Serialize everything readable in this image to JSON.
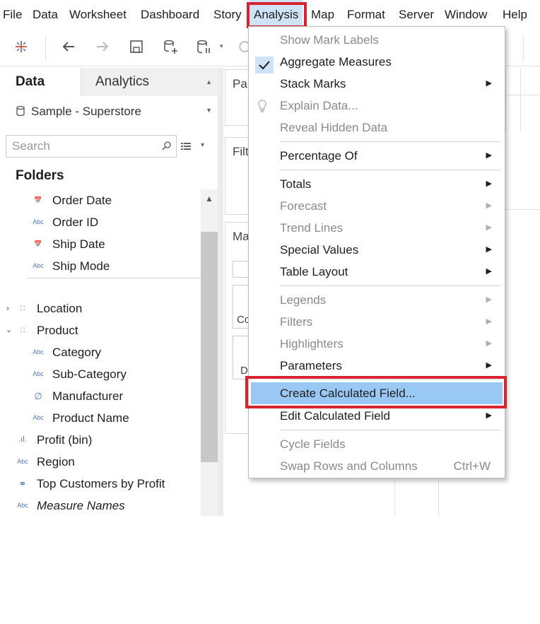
{
  "menubar": {
    "items": [
      "File",
      "Data",
      "Worksheet",
      "Dashboard",
      "Story",
      "Analysis",
      "Map",
      "Format",
      "Server",
      "Window",
      "Help"
    ]
  },
  "toolbar": {
    "icons": [
      "tableau-logo-icon",
      "back-icon",
      "forward-icon",
      "save-icon",
      "new-datasource-icon",
      "pause-updates-icon",
      "refresh-icon"
    ]
  },
  "left_pane": {
    "tab_data": "Data",
    "tab_analytics": "Analytics",
    "datasource": "Sample - Superstore",
    "search_placeholder": "Search",
    "folders_title": "Folders",
    "fields": [
      {
        "icon": "calendar",
        "label": "Order Date"
      },
      {
        "icon": "Abc",
        "label": "Order ID"
      },
      {
        "icon": "calendar",
        "label": "Ship Date"
      },
      {
        "icon": "Abc",
        "label": "Ship Mode"
      },
      {
        "icon": "hierarchy",
        "label": "Location"
      },
      {
        "icon": "hierarchy",
        "label": "Product"
      },
      {
        "icon": "Abc",
        "label": "Category"
      },
      {
        "icon": "Abc",
        "label": "Sub-Category"
      },
      {
        "icon": "paperclip",
        "label": "Manufacturer"
      },
      {
        "icon": "Abc",
        "label": "Product Name"
      },
      {
        "icon": "bin",
        "label": "Profit (bin)"
      },
      {
        "icon": "Abc",
        "label": "Region"
      },
      {
        "icon": "set",
        "label": "Top Customers by Profit"
      },
      {
        "icon": "Abc",
        "label": "Measure Names"
      }
    ]
  },
  "shelves": {
    "pages_partial": "Pa",
    "filters_partial": "Filt",
    "marks_partial": "Ma",
    "color_partial": "Co",
    "detail_partial": "D"
  },
  "analysis_menu": {
    "items": [
      {
        "label": "Show Mark Labels",
        "enabled": false
      },
      {
        "label": "Aggregate Measures",
        "enabled": true,
        "checked": true
      },
      {
        "label": "Stack Marks",
        "enabled": true,
        "submenu": true
      },
      {
        "label": "Explain Data...",
        "enabled": false,
        "icon": "lightbulb-icon"
      },
      {
        "label": "Reveal Hidden Data",
        "enabled": false
      },
      {
        "label": "Percentage Of",
        "enabled": true,
        "submenu": true
      },
      {
        "label": "Totals",
        "enabled": true,
        "submenu": true
      },
      {
        "label": "Forecast",
        "enabled": false,
        "submenu": true
      },
      {
        "label": "Trend Lines",
        "enabled": false,
        "submenu": true
      },
      {
        "label": "Special Values",
        "enabled": true,
        "submenu": true
      },
      {
        "label": "Table Layout",
        "enabled": true,
        "submenu": true
      },
      {
        "label": "Legends",
        "enabled": false,
        "submenu": true
      },
      {
        "label": "Filters",
        "enabled": false,
        "submenu": true
      },
      {
        "label": "Highlighters",
        "enabled": false,
        "submenu": true
      },
      {
        "label": "Parameters",
        "enabled": true,
        "submenu": true
      },
      {
        "label": "Create Calculated Field...",
        "enabled": true,
        "highlighted": true
      },
      {
        "label": "Edit Calculated Field",
        "enabled": true,
        "submenu": true
      },
      {
        "label": "Cycle Fields",
        "enabled": false
      },
      {
        "label": "Swap Rows and Columns",
        "enabled": false,
        "shortcut": "Ctrl+W"
      }
    ]
  },
  "colors": {
    "highlight": "#99c8f5",
    "menubar_active": "#cfe3f7",
    "callout_border": "#d9232e",
    "disabled_text": "#8a8a8a"
  }
}
